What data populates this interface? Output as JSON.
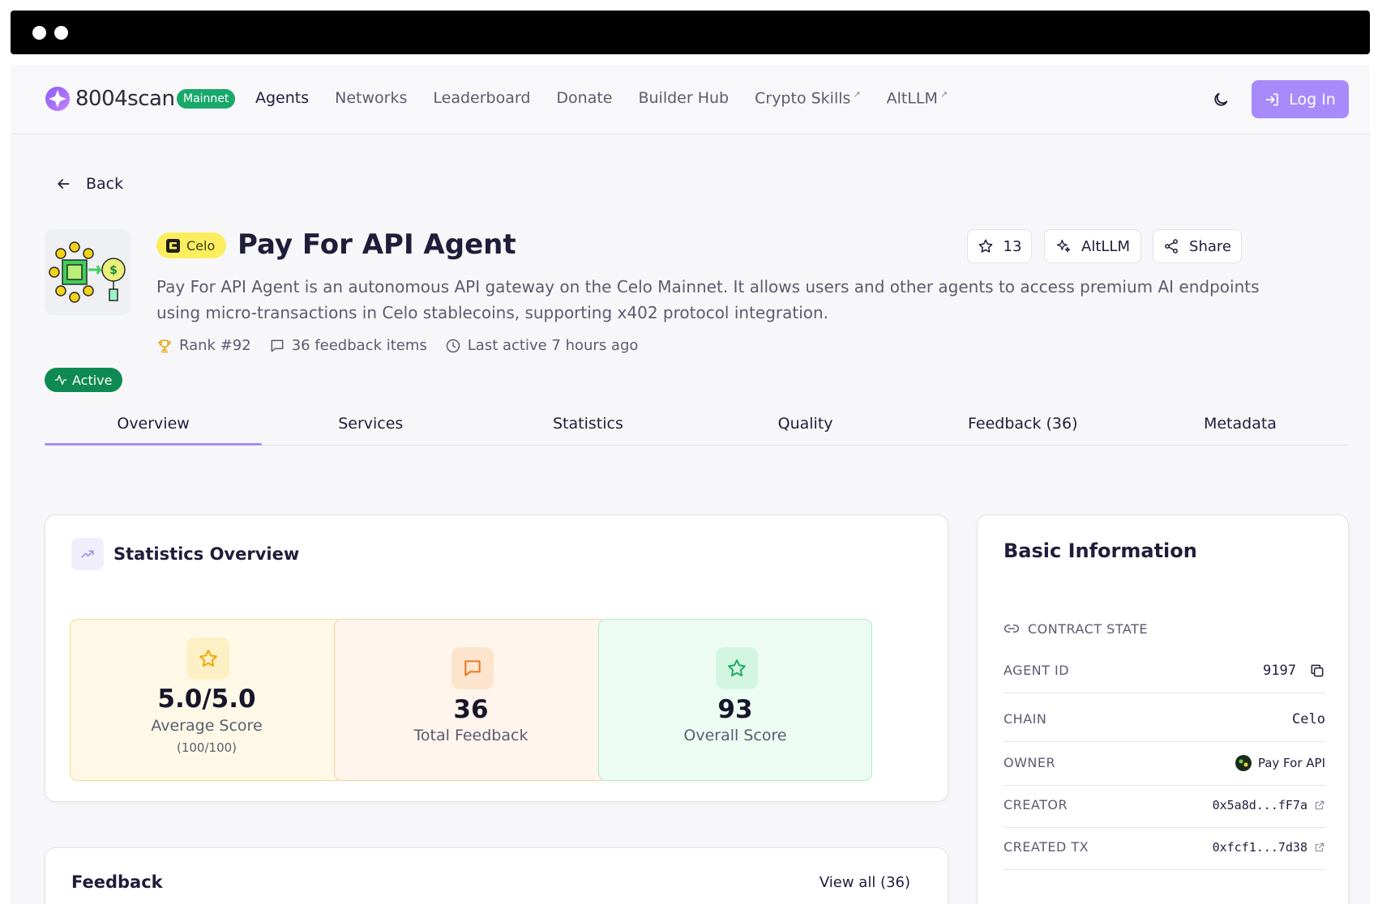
{
  "nav": {
    "logo": "8004scan",
    "network_badge": "Mainnet",
    "links": [
      {
        "label": "Agents"
      },
      {
        "label": "Networks"
      },
      {
        "label": "Leaderboard"
      },
      {
        "label": "Donate"
      },
      {
        "label": "Builder Hub"
      },
      {
        "label": "Crypto Skills",
        "external_mark": "↗"
      },
      {
        "label": "AltLLM",
        "external_mark": "↗"
      }
    ],
    "login_label": "Log In",
    "theme_icon": "moon-icon"
  },
  "back_label": "Back",
  "agent": {
    "chain": "Celo",
    "name": "Pay For API Agent",
    "description": "Pay For API Agent is an autonomous API gateway on the Celo Mainnet. It allows users and other agents to access premium AI endpoints using micro-transactions in Celo stablecoins, supporting x402 protocol integration.",
    "rank": "Rank #92",
    "feedback_items": "36 feedback items",
    "last_active": "Last active 7 hours ago",
    "status": "Active",
    "star_count": "13",
    "altllm_label": "AltLLM",
    "share_label": "Share"
  },
  "tabs": [
    {
      "label": "Overview"
    },
    {
      "label": "Services"
    },
    {
      "label": "Statistics"
    },
    {
      "label": "Quality"
    },
    {
      "label": "Feedback (36)"
    },
    {
      "label": "Metadata"
    }
  ],
  "stats": {
    "title": "Statistics Overview",
    "boxes": [
      {
        "value": "5.0/5.0",
        "label": "Average Score",
        "sub": "(100/100)",
        "bg": "#fef9e6",
        "border": "#f6dc8a",
        "icon_bg": "#fdf0c4",
        "icon_color": "#f0a500"
      },
      {
        "value": "36",
        "label": "Total Feedback",
        "bg": "#fff5ec",
        "border": "#f7cfa6",
        "icon_bg": "#fde4cc",
        "icon_color": "#e8731c"
      },
      {
        "value": "93",
        "label": "Overall Score",
        "bg": "#edfcf3",
        "border": "#a9ecc7",
        "icon_bg": "#d3f6e2",
        "icon_color": "#18a95f"
      }
    ]
  },
  "feedback": {
    "title": "Feedback",
    "view_all": "View all (36)"
  },
  "basic_info": {
    "title": "Basic Information",
    "section": "CONTRACT STATE",
    "rows": [
      {
        "key": "AGENT ID",
        "value": "9197"
      },
      {
        "key": "CHAIN",
        "value": "Celo"
      },
      {
        "key": "OWNER",
        "value": "Pay For API"
      },
      {
        "key": "CREATOR",
        "value": "0x5a8d...fF7a"
      },
      {
        "key": "CREATED TX",
        "value": "0xfcf1...7d38"
      }
    ]
  },
  "colors": {
    "accent": "#a78bfa",
    "active_green": "#0e8a52",
    "mainnet_green": "#1aa96b",
    "chain_yellow": "#fbee5e"
  }
}
